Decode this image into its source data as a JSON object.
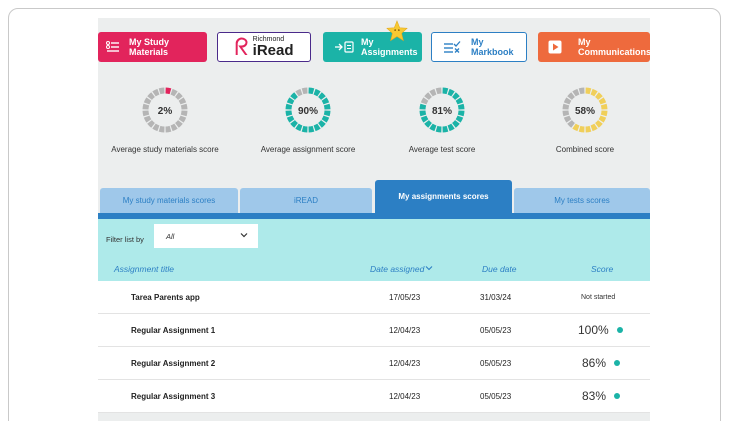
{
  "nav": {
    "study": "My Study Materials",
    "iread_small": "Richmond",
    "iread_big": "iRead",
    "assignments": "My Assignments",
    "markbook": "My Markbook",
    "communications": "My Communications"
  },
  "gauges": [
    {
      "value": "2%",
      "percent": 2,
      "label": "Average study materials score",
      "color": "#e2245c"
    },
    {
      "value": "90%",
      "percent": 90,
      "label": "Average assignment score",
      "color": "#1bb3a7"
    },
    {
      "value": "81%",
      "percent": 81,
      "label": "Average test score",
      "color": "#1bb3a7"
    },
    {
      "value": "58%",
      "percent": 58,
      "label": "Combined score",
      "color": "#f0cf5a"
    }
  ],
  "tabs": [
    {
      "label": "My study materials scores"
    },
    {
      "label": "iREAD"
    },
    {
      "label": "My assignments scores"
    },
    {
      "label": "My tests scores"
    }
  ],
  "filter": {
    "label": "Filter list by",
    "value": "All"
  },
  "table": {
    "headers": {
      "title": "Assignment title",
      "assigned": "Date assigned",
      "due": "Due date",
      "score": "Score"
    },
    "rows": [
      {
        "title": "Tarea Parents app",
        "assigned": "17/05/23",
        "due": "31/03/24",
        "score": "Not started"
      },
      {
        "title": "Regular Assignment 1",
        "assigned": "12/04/23",
        "due": "05/05/23",
        "score": "100%"
      },
      {
        "title": "Regular Assignment 2",
        "assigned": "12/04/23",
        "due": "05/05/23",
        "score": "86%"
      },
      {
        "title": "Regular Assignment 3",
        "assigned": "12/04/23",
        "due": "05/05/23",
        "score": "83%"
      }
    ]
  },
  "colors": {
    "pink": "#e2245c",
    "teal": "#1bb3a7",
    "blue": "#2c7fc4",
    "orange": "#ee6a3d",
    "yellow": "#f0cf5a",
    "gauge_track": "#b5b5b5"
  }
}
